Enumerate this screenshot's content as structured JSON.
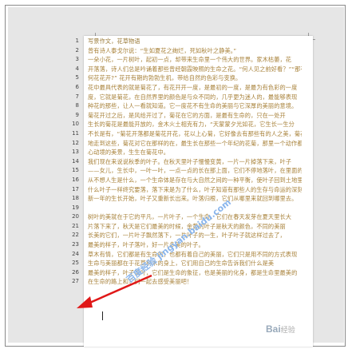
{
  "document": {
    "line_numbers": [
      "1",
      "2",
      "3",
      "4",
      "5",
      "6",
      "7",
      "8",
      "9",
      "10",
      "11",
      "12",
      "13",
      "14",
      "15",
      "16",
      "17",
      "18",
      "19",
      "20",
      "21",
      "22",
      "23",
      "24",
      "25",
      "26",
      "27"
    ],
    "lines": [
      "写景作文，花草物语",
      "    曾有诗人泰戈尔说：“生如夏花之绚烂，死如秋叶之静美。”",
      "    一朵小花，一片树叶，起初一点，却带来生命里一个伟大的世界。家木枯萎，花",
      "开落落，诗人们总是吟诵着那些曾经朝霞映照的生命之花。“何人见之前好看？”“那有",
      "何花花开?” 花开有期的勃勃生机，带给自然的色彩与变换。",
      "    花中最具代表的就是菊花了，有花开开一度，是最初的一度，是最为有色彩的一度",
      "度，它就是菊花，在自然界里的颜色是与众不同的，几乎更为迷人的，最能够表现",
      "种花的那些，让人一看就知道。它一度花不有生命的美丽与它深厚的美丽的意境。",
      "    菊花开过之后，是风给开过了，菊花在它的方面，是最有生命的，只在一处开",
      "    生长的菊花是最能开放的，金木火土相克有力，“天蒙蒙夕光如花，它生长一生分",
      "不长是有，“菊花开落都是菊花开花，花以上心菊，它好像去有那些有的人之美，菊花",
      "地走到这些，菊花对它在那样的在，最生长在那些一个年纪的花菊，那里一个动作都有着",
      "心动境的美景，生生在菊花中。",
      "    我们现在来说说秋季的叶子。在秋天里叶子慢慢变黄，一片一片掉落下来，叶子",
      "——女儿，生长中，一叶一叶，一点一点的长在那上面，它们不停地落叶，在里面的",
      "从不想人生是什么，一个生命体是存在与大自然之间的一种平衡，使叶子回到土地里",
      "什么叶子一样终究要落，落下来是为了什么，叶子知道有那些人的生存与命运的深刻",
      "新一年的生长开始，叶子又重新长出来。叶落归根，它们从哪里来就回到哪里去。",
      "",
      "    树叶的美就在于它的平凡，一片叶子，一个生命。它们在春天发芽在夏天里长大",
      "片落下来了，秋天是它们最美的时候，金黄的叶子是秋天的颜色，不同的美丽",
      "长美的它们，一片叶子飘然落下，一片叶子的一生，叶子叶子就这样过去了，",
      "最美的样子，叶子落叶，好一片多美的叶子。",
      "    草木有情，它们都是有生命的，也都有着自己的美丽，它们只是用不同的方式表现",
      "    生命与美丽都在于花草树木的身上，它们用自己的生命告诉我们什么是美",
      "最美的样子，叶子落叶，它们是生命的象征，也是美丽的化身，都是生命里最美的",
      "    在生命的路上和它们一起去感受美丽吧！"
    ]
  },
  "watermark_text": "百度经验 jingyan.baidu.com",
  "brand": {
    "logo_text": "Bai",
    "logo_suffix": "经验"
  }
}
